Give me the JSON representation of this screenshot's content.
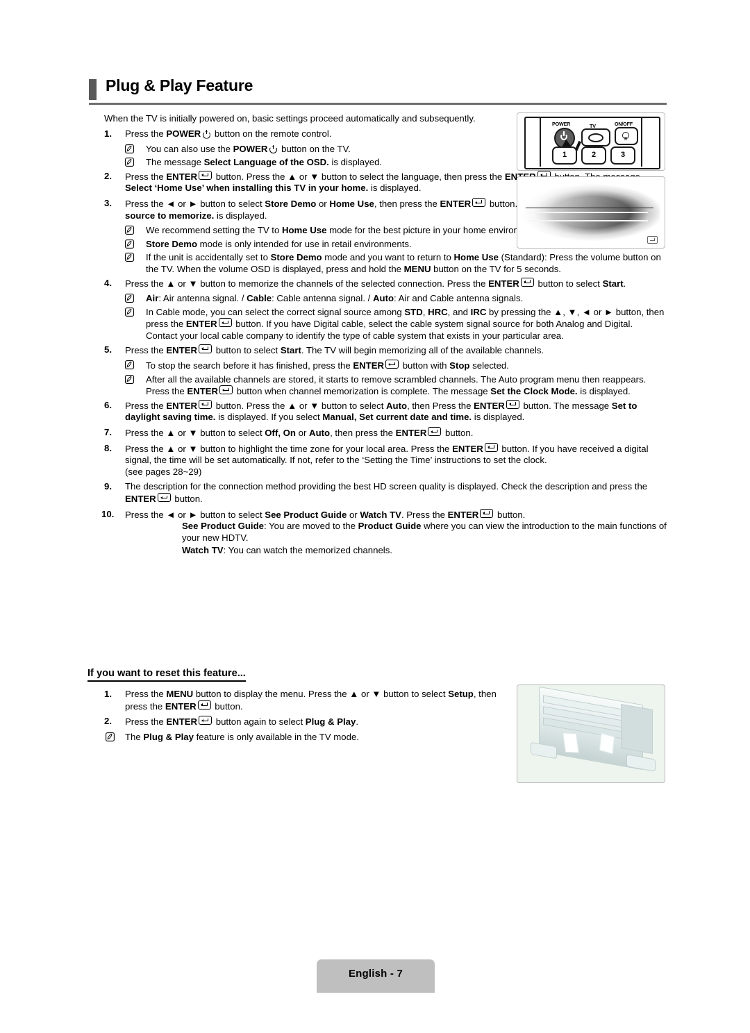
{
  "page": {
    "title": "Plug & Play Feature",
    "footer_label": "English - 7",
    "intro": "When the TV is initially powered on, basic settings proceed automatically and subsequently."
  },
  "glyphs": {
    "enter_key": "enter-key-glyph",
    "power_key": "power-glyph",
    "note_bullet": "pencil-note-icon",
    "up_arrow": "▲",
    "down_arrow": "▼",
    "left_arrow": "◄",
    "right_arrow": "►"
  },
  "steps": [
    {
      "num": "1.",
      "text_html": "Press the <b>POWER</b><span class=\"keypower\" data-name=\"power-glyph\" data-interactable=\"false\"></span> button on the remote control.",
      "notes": [
        "You can also use the <b>POWER</b><span class=\"keypower\"></span> button on the TV.",
        "The message <b>Select Language of the OSD.</b> is displayed."
      ]
    },
    {
      "num": "2.",
      "text_html": "Press the <b>ENTER</b><span class=\"keyenter\"></span> button. Press the ▲ or ▼ button to select the language, then press the <b>ENTER</b><span class=\"keyenter\"></span> button. The message <b>Select ‘Home Use’ when installing this TV in your home.</b> is displayed.",
      "notes": []
    },
    {
      "num": "3.",
      "text_html": "Press the ◄ or ► button to select <b>Store Demo</b> or <b>Home Use</b>, then press the <b>ENTER</b><span class=\"keyenter\"></span> button. The message <b>Select the Antenna source to memorize.</b> is displayed.",
      "notes": [
        "We recommend setting the TV to <b>Home Use</b> mode for the best picture in your home environment.",
        "<b>Store Demo</b> mode is only intended for use in retail environments.",
        "If the unit is accidentally set to <b>Store Demo</b> mode and you want to return to <b>Home Use</b> (Standard): Press the volume button on the TV. When the volume OSD is displayed, press and hold the <b>MENU</b> button on the TV for 5 seconds."
      ]
    },
    {
      "num": "4.",
      "text_html": "Press the ▲ or ▼ button to memorize the channels of the selected connection. Press the <b>ENTER</b><span class=\"keyenter\"></span> button to select <b>Start</b>.",
      "notes": [
        "<b>Air</b>: Air antenna signal. / <b>Cable</b>: Cable antenna signal. / <b>Auto</b>: Air and Cable antenna signals.",
        "In Cable mode, you can select the correct signal source among <b>STD</b>, <b>HRC</b>, and <b>IRC</b> by pressing the ▲, ▼, ◄ or ► button, then press the <b>ENTER</b><span class=\"keyenter\"></span> button. If you have Digital cable, select the cable system signal source for both Analog and Digital. Contact your local cable company to identify the type of cable system that exists in your particular area."
      ]
    },
    {
      "num": "5.",
      "text_html": "Press the <b>ENTER</b><span class=\"keyenter\"></span> button to select <b>Start</b>. The TV will begin memorizing all of the available channels.",
      "notes": [
        "To stop the search before it has finished, press the <b>ENTER</b><span class=\"keyenter\"></span> button with <b>Stop</b> selected.",
        "After all the available channels are stored, it starts to remove scrambled channels. The Auto program menu then reappears. Press the <b>ENTER</b><span class=\"keyenter\"></span> button when channel memorization is complete. The message <b>Set the Clock Mode.</b> is displayed."
      ]
    },
    {
      "num": "6.",
      "text_html": "Press the <b>ENTER</b><span class=\"keyenter\"></span> button. Press the ▲ or ▼ button to select <b>Auto</b>, then Press the <b>ENTER</b><span class=\"keyenter\"></span> button. The message <b>Set to daylight saving time.</b> is displayed. If you select <b>Manual, Set current date and time.</b> is displayed.",
      "notes": []
    },
    {
      "num": "7.",
      "text_html": "Press the ▲ or ▼ button to select <b>Off, On</b> or <b>Auto</b>, then press the <b>ENTER</b><span class=\"keyenter\"></span> button.",
      "notes": []
    },
    {
      "num": "8.",
      "text_html": "Press the ▲ or ▼ button to highlight the time zone for your local area. Press the <b>ENTER</b><span class=\"keyenter\"></span> button. If you have received a digital signal, the time will be set automatically. If not, refer to the ‘Setting the Time’ instructions to set the clock.<br>(see pages 28~29)",
      "notes": []
    },
    {
      "num": "9.",
      "text_html": "The description for the connection method providing the best HD screen quality is displayed. Check the description and press the <b>ENTER</b><span class=\"keyenter\"></span> button.",
      "notes": []
    },
    {
      "num": "10.",
      "text_html": "Press the ◄ or ► button to select <b>See Product Guide</b> or <b>Watch TV</b>. Press the <b>ENTER</b><span class=\"keyenter\"></span> button.",
      "notes": [],
      "subtexts": [
        "<b>See Product Guide</b>: You are moved to the <b>Product Guide</b> where you can view the introduction to the main functions of your new HDTV.",
        "<b>Watch TV</b>: You can watch the memorized channels."
      ]
    }
  ],
  "reset_section": {
    "heading": "If you want to reset this feature...",
    "steps": [
      {
        "num": "1.",
        "text_html": "Press the <b>MENU</b> button to display the menu. Press the ▲ or ▼ button to select <b>Setup</b>, then press the <b>ENTER</b><span class=\"keyenter\"></span> button."
      },
      {
        "num": "2.",
        "text_html": "Press the <b>ENTER</b><span class=\"keyenter\"></span> button again to select <b>Plug & Play</b>."
      }
    ],
    "notes": [
      "The <b>Plug & Play</b> feature is only available in the TV mode."
    ]
  },
  "figures": {
    "remote": {
      "name": "remote-control-illustration",
      "power_label": "POWER",
      "tv_label": "TV",
      "onoff_label": "ON/OFF",
      "num_buttons": [
        "1",
        "2",
        "3"
      ]
    },
    "osd": {
      "name": "osd-screenshot-blurred"
    },
    "menu": {
      "name": "setup-menu-screenshot"
    }
  },
  "colors": {
    "title_bar": "#5a5a5a",
    "rule": "#6e6e6e",
    "footer_bg": "#bfbfbf",
    "figure_border": "#b9b9b9"
  }
}
